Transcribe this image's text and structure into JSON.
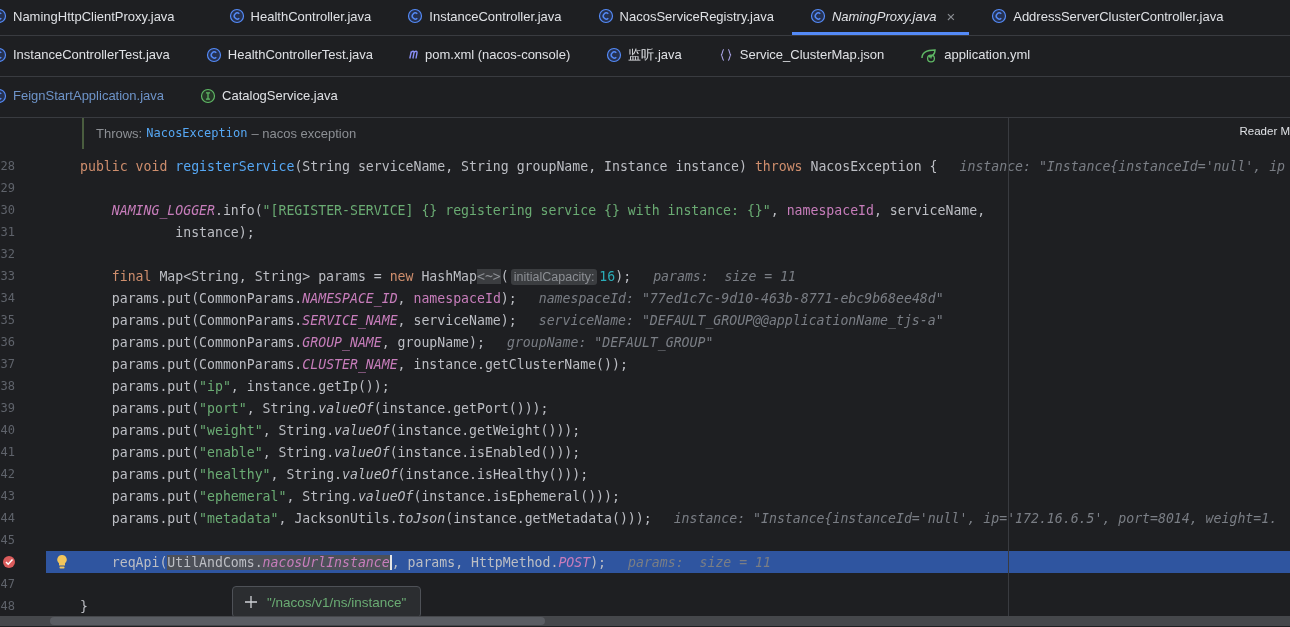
{
  "tab_rows": [
    [
      {
        "label": "NamingHttpClientProxy.java",
        "kind": "class",
        "selected": false,
        "dimmed": false
      },
      {
        "label": "HealthController.java",
        "kind": "class",
        "selected": false,
        "dimmed": false
      },
      {
        "label": "InstanceController.java",
        "kind": "class",
        "selected": false,
        "dimmed": false
      },
      {
        "label": "NacosServiceRegistry.java",
        "kind": "class",
        "selected": false,
        "dimmed": false
      },
      {
        "label": "NamingProxy.java",
        "kind": "class",
        "selected": true,
        "dimmed": false,
        "close": "×"
      },
      {
        "label": "AddressServerClusterController.java",
        "kind": "class",
        "selected": false,
        "dimmed": false
      }
    ],
    [
      {
        "label": "InstanceControllerTest.java",
        "kind": "class",
        "selected": false,
        "dimmed": false
      },
      {
        "label": "HealthControllerTest.java",
        "kind": "class",
        "selected": false,
        "dimmed": false
      },
      {
        "label": "pom.xml (nacos-console)",
        "kind": "maven",
        "selected": false,
        "dimmed": false
      },
      {
        "label": "监听.java",
        "kind": "class",
        "selected": false,
        "dimmed": false
      },
      {
        "label": "Service_ClusterMap.json",
        "kind": "json",
        "selected": false,
        "dimmed": false
      },
      {
        "label": "application.yml",
        "kind": "yaml",
        "selected": false,
        "dimmed": false
      }
    ],
    [
      {
        "label": "FeignStartApplication.java",
        "kind": "class",
        "selected": false,
        "dimmed": true
      },
      {
        "label": "CatalogService.java",
        "kind": "interface",
        "selected": false,
        "dimmed": false
      }
    ]
  ],
  "doc": {
    "throws_label": "Throws:",
    "exception": "NacosException",
    "description": "– nacos exception",
    "reader_mode": "Reader M"
  },
  "lines": [
    {
      "number": "28",
      "kind": "member",
      "current": false,
      "breakpoint": false,
      "intention": false,
      "tokens": [
        {
          "text": "public void ",
          "kind": "kw"
        },
        {
          "text": "registerService",
          "kind": "decl"
        },
        {
          "text": "(String serviceName, String groupName, Instance instance) ",
          "kind": "plain"
        },
        {
          "text": "throws ",
          "kind": "kw"
        },
        {
          "text": "NacosException {",
          "kind": "plain"
        }
      ],
      "hint": "instance: \"Instance{instanceId='null', ip"
    },
    {
      "number": "29",
      "kind": "body",
      "current": false,
      "breakpoint": false,
      "intention": false
    },
    {
      "number": "30",
      "kind": "body",
      "current": false,
      "breakpoint": false,
      "intention": false,
      "tokens": [
        {
          "text": "NAMING_LOGGER",
          "kind": "field"
        },
        {
          "text": ".info(",
          "kind": "plain"
        },
        {
          "text": "\"[REGISTER-SERVICE] {} registering service {} with instance: {}\"",
          "kind": "str"
        },
        {
          "text": ", ",
          "kind": "plain"
        },
        {
          "text": "namespaceId",
          "kind": "local"
        },
        {
          "text": ", serviceName,",
          "kind": "plain"
        }
      ]
    },
    {
      "number": "31",
      "kind": "continuation",
      "current": false,
      "breakpoint": false,
      "intention": false,
      "tokens": [
        {
          "text": "instance);",
          "kind": "plain"
        }
      ]
    },
    {
      "number": "32",
      "kind": "body",
      "current": false,
      "breakpoint": false,
      "intention": false
    },
    {
      "number": "33",
      "kind": "body",
      "current": false,
      "breakpoint": false,
      "intention": false,
      "tokens": [
        {
          "text": "final ",
          "kind": "kw"
        },
        {
          "text": "Map<String, String> params = ",
          "kind": "plain"
        },
        {
          "text": "new ",
          "kind": "kw"
        },
        {
          "text": "HashMap",
          "kind": "plain"
        },
        {
          "text": "<~>",
          "kind": "fold"
        },
        {
          "text": "(",
          "kind": "plain"
        },
        {
          "text": "initialCapacity:",
          "kind": "inlay"
        },
        {
          "text": "16",
          "kind": "num"
        },
        {
          "text": ");",
          "kind": "plain"
        }
      ],
      "hint": "params:  size = 11"
    },
    {
      "number": "34",
      "kind": "body",
      "current": false,
      "breakpoint": false,
      "intention": false,
      "tokens": [
        {
          "text": "params.put(CommonParams.",
          "kind": "plain"
        },
        {
          "text": "NAMESPACE_ID",
          "kind": "field"
        },
        {
          "text": ", ",
          "kind": "plain"
        },
        {
          "text": "namespaceId",
          "kind": "local"
        },
        {
          "text": ");",
          "kind": "plain"
        }
      ],
      "hint": "namespaceId: \"77ed1c7c-9d10-463b-8771-ebc9b68ee48d\""
    },
    {
      "number": "35",
      "kind": "body",
      "current": false,
      "breakpoint": false,
      "intention": false,
      "tokens": [
        {
          "text": "params.put(CommonParams.",
          "kind": "plain"
        },
        {
          "text": "SERVICE_NAME",
          "kind": "field"
        },
        {
          "text": ", serviceName);",
          "kind": "plain"
        }
      ],
      "hint": "serviceName: \"DEFAULT_GROUP@@applicationName_tjs-a\""
    },
    {
      "number": "36",
      "kind": "body",
      "current": false,
      "breakpoint": false,
      "intention": false,
      "tokens": [
        {
          "text": "params.put(CommonParams.",
          "kind": "plain"
        },
        {
          "text": "GROUP_NAME",
          "kind": "field"
        },
        {
          "text": ", groupName);",
          "kind": "plain"
        }
      ],
      "hint": "groupName: \"DEFAULT_GROUP\""
    },
    {
      "number": "37",
      "kind": "body",
      "current": false,
      "breakpoint": false,
      "intention": false,
      "tokens": [
        {
          "text": "params.put(CommonParams.",
          "kind": "plain"
        },
        {
          "text": "CLUSTER_NAME",
          "kind": "field"
        },
        {
          "text": ", instance.getClusterName());",
          "kind": "plain"
        }
      ]
    },
    {
      "number": "38",
      "kind": "body",
      "current": false,
      "breakpoint": false,
      "intention": false,
      "tokens": [
        {
          "text": "params.put(",
          "kind": "plain"
        },
        {
          "text": "\"ip\"",
          "kind": "str"
        },
        {
          "text": ", instance.getIp());",
          "kind": "plain"
        }
      ]
    },
    {
      "number": "39",
      "kind": "body",
      "current": false,
      "breakpoint": false,
      "intention": false,
      "tokens": [
        {
          "text": "params.put(",
          "kind": "plain"
        },
        {
          "text": "\"port\"",
          "kind": "str"
        },
        {
          "text": ", String.",
          "kind": "plain"
        },
        {
          "text": "valueOf",
          "kind": "static"
        },
        {
          "text": "(instance.getPort()));",
          "kind": "plain"
        }
      ]
    },
    {
      "number": "40",
      "kind": "body",
      "current": false,
      "breakpoint": false,
      "intention": false,
      "tokens": [
        {
          "text": "params.put(",
          "kind": "plain"
        },
        {
          "text": "\"weight\"",
          "kind": "str"
        },
        {
          "text": ", String.",
          "kind": "plain"
        },
        {
          "text": "valueOf",
          "kind": "static"
        },
        {
          "text": "(instance.getWeight()));",
          "kind": "plain"
        }
      ]
    },
    {
      "number": "41",
      "kind": "body",
      "current": false,
      "breakpoint": false,
      "intention": false,
      "tokens": [
        {
          "text": "params.put(",
          "kind": "plain"
        },
        {
          "text": "\"enable\"",
          "kind": "str"
        },
        {
          "text": ", String.",
          "kind": "plain"
        },
        {
          "text": "valueOf",
          "kind": "static"
        },
        {
          "text": "(instance.isEnabled()));",
          "kind": "plain"
        }
      ]
    },
    {
      "number": "42",
      "kind": "body",
      "current": false,
      "breakpoint": false,
      "intention": false,
      "tokens": [
        {
          "text": "params.put(",
          "kind": "plain"
        },
        {
          "text": "\"healthy\"",
          "kind": "str"
        },
        {
          "text": ", String.",
          "kind": "plain"
        },
        {
          "text": "valueOf",
          "kind": "static"
        },
        {
          "text": "(instance.isHealthy()));",
          "kind": "plain"
        }
      ]
    },
    {
      "number": "43",
      "kind": "body",
      "current": false,
      "breakpoint": false,
      "intention": false,
      "tokens": [
        {
          "text": "params.put(",
          "kind": "plain"
        },
        {
          "text": "\"ephemeral\"",
          "kind": "str"
        },
        {
          "text": ", String.",
          "kind": "plain"
        },
        {
          "text": "valueOf",
          "kind": "static"
        },
        {
          "text": "(instance.isEphemeral()));",
          "kind": "plain"
        }
      ]
    },
    {
      "number": "44",
      "kind": "body",
      "current": false,
      "breakpoint": false,
      "intention": false,
      "tokens": [
        {
          "text": "params.put(",
          "kind": "plain"
        },
        {
          "text": "\"metadata\"",
          "kind": "str"
        },
        {
          "text": ", JacksonUtils.",
          "kind": "plain"
        },
        {
          "text": "toJson",
          "kind": "static"
        },
        {
          "text": "(instance.getMetadata()));",
          "kind": "plain"
        }
      ],
      "hint": "instance: \"Instance{instanceId='null', ip='172.16.6.5', port=8014, weight=1."
    },
    {
      "number": "45",
      "kind": "body",
      "current": false,
      "breakpoint": false,
      "intention": false
    },
    {
      "kind": "body",
      "current": true,
      "breakpoint": true,
      "intention": true,
      "tokens": [
        {
          "text": "reqApi(",
          "kind": "plain"
        },
        {
          "text": "UtilAndComs.",
          "kind": "hover-plain"
        },
        {
          "text": "nacosUrlInstance",
          "kind": "hover-field"
        },
        {
          "text": ", params, HttpMethod.",
          "kind": "plain"
        },
        {
          "text": "POST",
          "kind": "field"
        },
        {
          "text": ");",
          "kind": "plain"
        }
      ],
      "hint": "params:  size = 11"
    },
    {
      "number": "47",
      "kind": "body",
      "current": false,
      "breakpoint": false,
      "intention": false
    },
    {
      "number": "48",
      "kind": "member",
      "current": false,
      "breakpoint": false,
      "intention": false,
      "tokens": [
        {
          "text": "}",
          "kind": "plain"
        }
      ]
    }
  ],
  "popup": {
    "value": "\"/nacos/v1/ns/instance\""
  }
}
